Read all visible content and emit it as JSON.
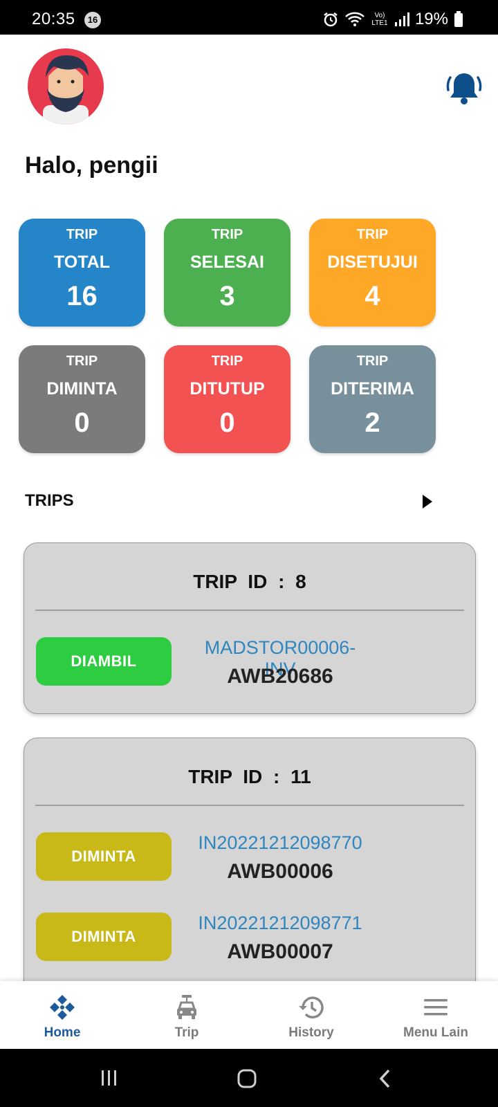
{
  "status_bar": {
    "time": "20:35",
    "notification_count": "16",
    "network_label": "Vo) LTE1",
    "battery": "19%"
  },
  "header": {
    "greeting": "Halo, pengii",
    "bell_color": "#0d4f8b"
  },
  "stats": [
    {
      "line1": "TRIP",
      "line2": "TOTAL",
      "value": "16",
      "color": "#2486c9"
    },
    {
      "line1": "TRIP",
      "line2": "SELESAI",
      "value": "3",
      "color": "#4caf50"
    },
    {
      "line1": "TRIP",
      "line2": "DISETUJUI",
      "value": "4",
      "color": "#ffa726"
    },
    {
      "line1": "TRIP",
      "line2": "DIMINTA",
      "value": "0",
      "color": "#7b7b7b"
    },
    {
      "line1": "TRIP",
      "line2": "DITUTUP",
      "value": "0",
      "color": "#f25252"
    },
    {
      "line1": "TRIP",
      "line2": "DITERIMA",
      "value": "2",
      "color": "#78909c"
    }
  ],
  "trips_section": {
    "title": "TRIPS"
  },
  "trips": [
    {
      "title": "TRIP  ID :  8",
      "items": [
        {
          "status": "DIAMBIL",
          "status_color": "#2ecc40",
          "invoice": "MADSTOR00006-INV",
          "awb": "AWB20686"
        }
      ]
    },
    {
      "title": "TRIP  ID :  11",
      "items": [
        {
          "status": "DIMINTA",
          "status_color": "#c8b918",
          "invoice": "IN20221212098770",
          "awb": "AWB00006"
        },
        {
          "status": "DIMINTA",
          "status_color": "#c8b918",
          "invoice": "IN20221212098771",
          "awb": "AWB00007"
        }
      ]
    }
  ],
  "bottom_nav": [
    {
      "label": "Home",
      "icon": "home-icon",
      "active": true
    },
    {
      "label": "Trip",
      "icon": "car-icon",
      "active": false
    },
    {
      "label": "History",
      "icon": "history-icon",
      "active": false
    },
    {
      "label": "Menu Lain",
      "icon": "menu-icon",
      "active": false
    }
  ]
}
